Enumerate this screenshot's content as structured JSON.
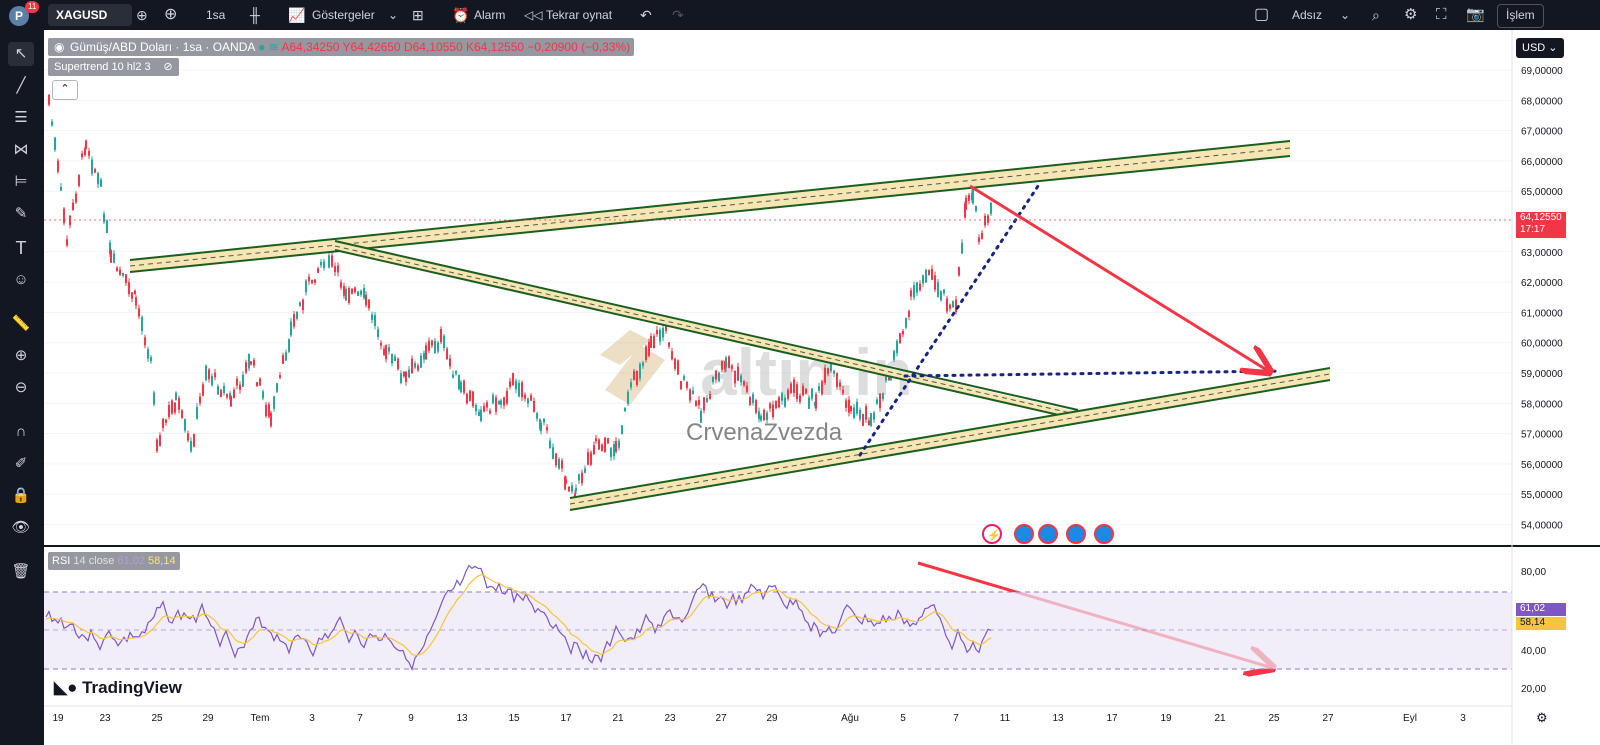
{
  "topbar": {
    "avatar_letter": "P",
    "notification_count": "11",
    "symbol": "XAGUSD",
    "interval": "1sa",
    "indicators_label": "Göstergeler",
    "alarm_label": "Alarm",
    "replay_label": "Tekrar oynat",
    "layout_name": "Adsız",
    "trade_label": "İşlem"
  },
  "legend": {
    "instrument": "Gümüş/ABD Doları · 1sa · OANDA",
    "ohlc": "A64,34250 Y64,42650 D64,10550 K64,12550 −0,20900 (−0,33%)",
    "indicator": "Supertrend 10 hl2 3"
  },
  "rsi": {
    "label": "RSI",
    "params": "14 close",
    "value1": "61,02",
    "value2": "58,14"
  },
  "price_scale": {
    "currency": "USD",
    "labels": [
      "69,00000",
      "68,00000",
      "67,00000",
      "66,00000",
      "65,00000",
      "63,00000",
      "62,00000",
      "61,00000",
      "60,00000",
      "59,00000",
      "58,00000",
      "57,00000",
      "56,00000",
      "55,00000",
      "54,00000"
    ],
    "current_price": "64,12550",
    "countdown": "17:17",
    "rsi_labels": [
      "80,00",
      "40,00",
      "20,00"
    ]
  },
  "time_axis": {
    "labels": [
      "19",
      "23",
      "25",
      "29",
      "Tem",
      "3",
      "7",
      "9",
      "13",
      "15",
      "17",
      "21",
      "23",
      "27",
      "29",
      "Ağu",
      "5",
      "7",
      "11",
      "13",
      "17",
      "19",
      "21",
      "25",
      "27",
      "Eyl",
      "3"
    ]
  },
  "watermark": {
    "brand": "altin.in",
    "author": "CrvenaZvezda"
  },
  "logo": "TradingView",
  "colors": {
    "up": "#26a69a",
    "down": "#f23645",
    "channel_line": "#1b5e20",
    "channel_fill": "#f5e6b3",
    "arrow": "#f23645",
    "rsi_line": "#7e57c2",
    "rsi_ma": "#f5c542",
    "trendline_dots": "#1a237e",
    "topbar_bg": "#131722"
  }
}
